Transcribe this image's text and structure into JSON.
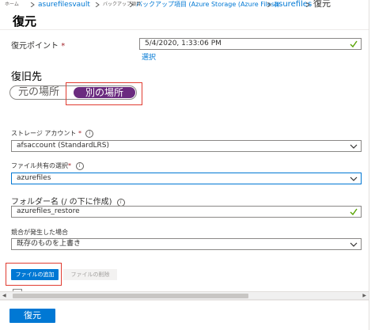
{
  "breadcrumb": {
    "items": [
      {
        "label": "ホーム"
      },
      {
        "label": "asurefilesvault"
      },
      {
        "label": "バックアップ項目"
      },
      {
        "label": "バックアップ項目 (Azure Storage (Azure Files))"
      },
      {
        "label": "asurefiles"
      }
    ],
    "current": "復元"
  },
  "blade": {
    "title": "復元"
  },
  "restore_point": {
    "label": "復元ポイント",
    "required_mark": "*",
    "value": "5/4/2020, 1:33:06 PM",
    "select_link": "選択"
  },
  "destination": {
    "heading": "復旧先",
    "options": [
      "元の場所",
      "別の場所"
    ],
    "selected": "別の場所"
  },
  "storage_account": {
    "label": "ストレージ アカウント",
    "required_mark": "*",
    "value": "afsaccount (StandardLRS)"
  },
  "file_share": {
    "label": "ファイル共有の選択",
    "required_mark": "*",
    "value": "azurefiles"
  },
  "folder": {
    "label": "フォルダー名 (/ の下に作成)",
    "value": "azurefiles_restore"
  },
  "conflict": {
    "label": "競合が発生した場合",
    "value": "既存のものを上書き"
  },
  "file_buttons": {
    "add": "ファイルの追加",
    "remove": "ファイルの削除"
  },
  "footer": {
    "restore_button": "復元"
  },
  "colors": {
    "accent": "#0078d4",
    "toggle_selected": "#6b2b7f",
    "highlight_box": "#e03c31",
    "valid_check": "#57a300"
  }
}
